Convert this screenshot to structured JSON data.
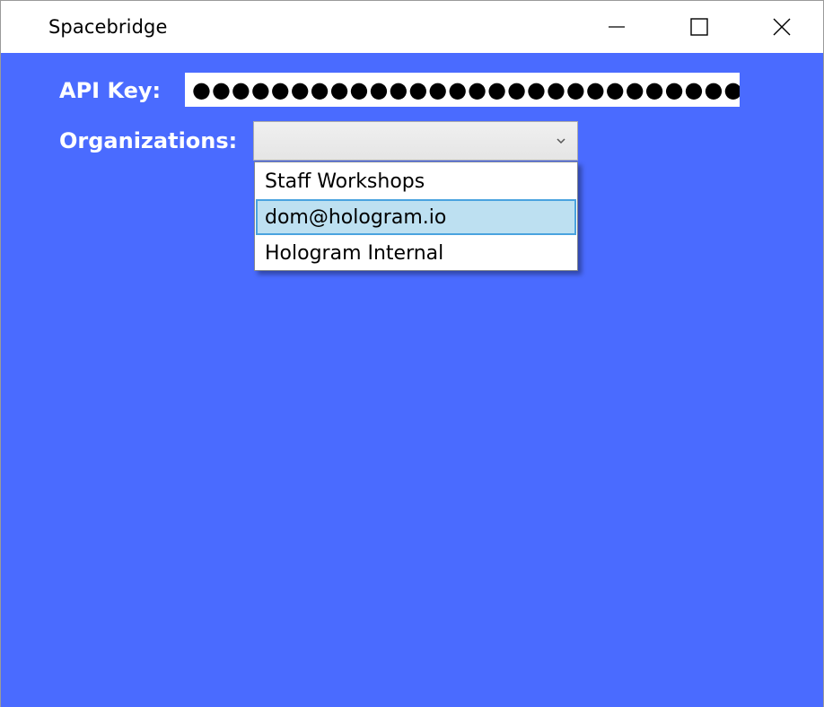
{
  "window": {
    "title": "Spacebridge",
    "controls": {
      "minimize_icon": "minimize-icon",
      "maximize_icon": "maximize-icon",
      "close_icon": "close-icon"
    }
  },
  "form": {
    "api_key_label": "API Key:",
    "api_key_value": "●●●●●●●●●●●●●●●●●●●●●●●●●●●●●",
    "organizations_label": "Organizations:",
    "organizations_selected": "",
    "organizations_options": [
      {
        "label": "Staff Workshops",
        "highlighted": false
      },
      {
        "label": "dom@hologram.io",
        "highlighted": true
      },
      {
        "label": "Hologram Internal",
        "highlighted": false
      }
    ]
  },
  "colors": {
    "background": "#4a6bff",
    "highlight": "#bde0f1",
    "highlight_border": "#4aa3df"
  }
}
